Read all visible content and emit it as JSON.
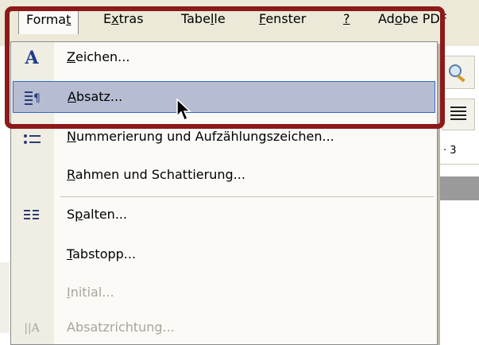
{
  "menubar": {
    "items": [
      {
        "label_pre": "Forma",
        "label_u": "t",
        "label_post": ""
      },
      {
        "label_pre": "E",
        "label_u": "x",
        "label_post": "tras"
      },
      {
        "label_pre": "Tabe",
        "label_u": "l",
        "label_post": "le"
      },
      {
        "label_pre": "",
        "label_u": "F",
        "label_post": "enster"
      },
      {
        "label_pre": "",
        "label_u": "?",
        "label_post": ""
      },
      {
        "label_pre": "Ad",
        "label_u": "o",
        "label_post": "be PDF"
      }
    ]
  },
  "menu": {
    "items": [
      {
        "u": "Z",
        "rest": "eichen...",
        "icon": "font-a-icon",
        "enabled": true
      },
      {
        "u": "A",
        "rest": "bsatz...",
        "icon": "paragraph-icon",
        "enabled": true,
        "highlighted": true
      },
      {
        "u": "N",
        "rest": "ummerierung und Aufzählungszeichen...",
        "icon": "bullets-icon",
        "enabled": true
      },
      {
        "u": "R",
        "rest": "ahmen und Schattierung...",
        "icon": "",
        "enabled": true
      },
      {
        "pre": "S",
        "u": "p",
        "rest": "alten...",
        "icon": "columns-icon",
        "enabled": true
      },
      {
        "u": "T",
        "rest": "abstopp...",
        "icon": "",
        "enabled": true
      },
      {
        "u": "I",
        "rest": "nitial...",
        "icon": "",
        "enabled": false
      },
      {
        "u": "",
        "rest": "Absatzrichtung...",
        "icon": "text-direction-icon",
        "enabled": false
      }
    ]
  },
  "ruler": {
    "number": "· 3"
  },
  "colors": {
    "highlight_border": "#8c1a1a",
    "selected_bg": "#b6bdd2",
    "selected_border": "#316ac5"
  }
}
